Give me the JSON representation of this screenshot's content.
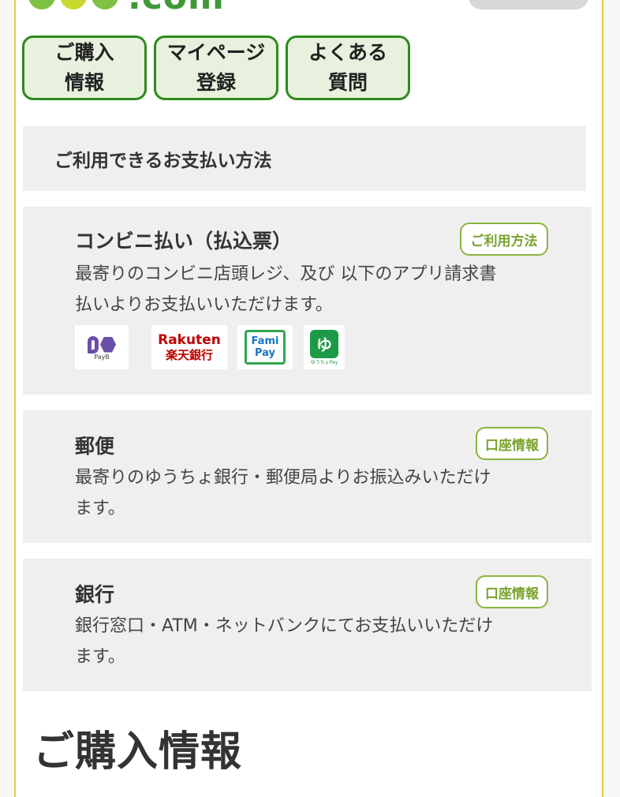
{
  "header": {
    "logo_text": ".com"
  },
  "nav": [
    {
      "line1": "ご購入",
      "line2": "情報"
    },
    {
      "line1": "マイページ",
      "line2": "登録"
    },
    {
      "line1": "よくある",
      "line2": "質問"
    }
  ],
  "payment_section": {
    "heading": "ご利用できるお支払い方法"
  },
  "methods": {
    "convenience": {
      "title": "コンビニ払い（払込票）",
      "button": "ご利用方法",
      "desc_line1": "最寄りのコンビニ店頭レジ、及び 以下のアプリ請求書",
      "desc_line2": "払いよりお支払いいただけます。",
      "logos": {
        "payb": "PayB",
        "rakuten_en": "Rakuten",
        "rakuten_jp": "楽天銀行",
        "fami_1": "Fami",
        "fami_2": "Pay",
        "yucho_mark": "ゆ",
        "yucho_sub": "ゆうちょPay"
      }
    },
    "postal": {
      "title": "郵便",
      "button": "口座情報",
      "desc_line1": "最寄りのゆうちょ銀行・郵便局よりお振込みいただけ",
      "desc_line2": "ます。"
    },
    "bank": {
      "title": "銀行",
      "button": "口座情報",
      "desc_line1": "銀行窓口・ATM・ネットバンクにてお支払いいただけ",
      "desc_line2": "ます。"
    }
  },
  "purchase_section": {
    "heading": "ご購入情報"
  },
  "colors": {
    "nav_border": "#2e8b1d",
    "nav_bg": "#e7f1dd",
    "tag_green": "#8bb33c",
    "frame_yellow": "#e8c94a",
    "panel_gray": "#efefef"
  }
}
